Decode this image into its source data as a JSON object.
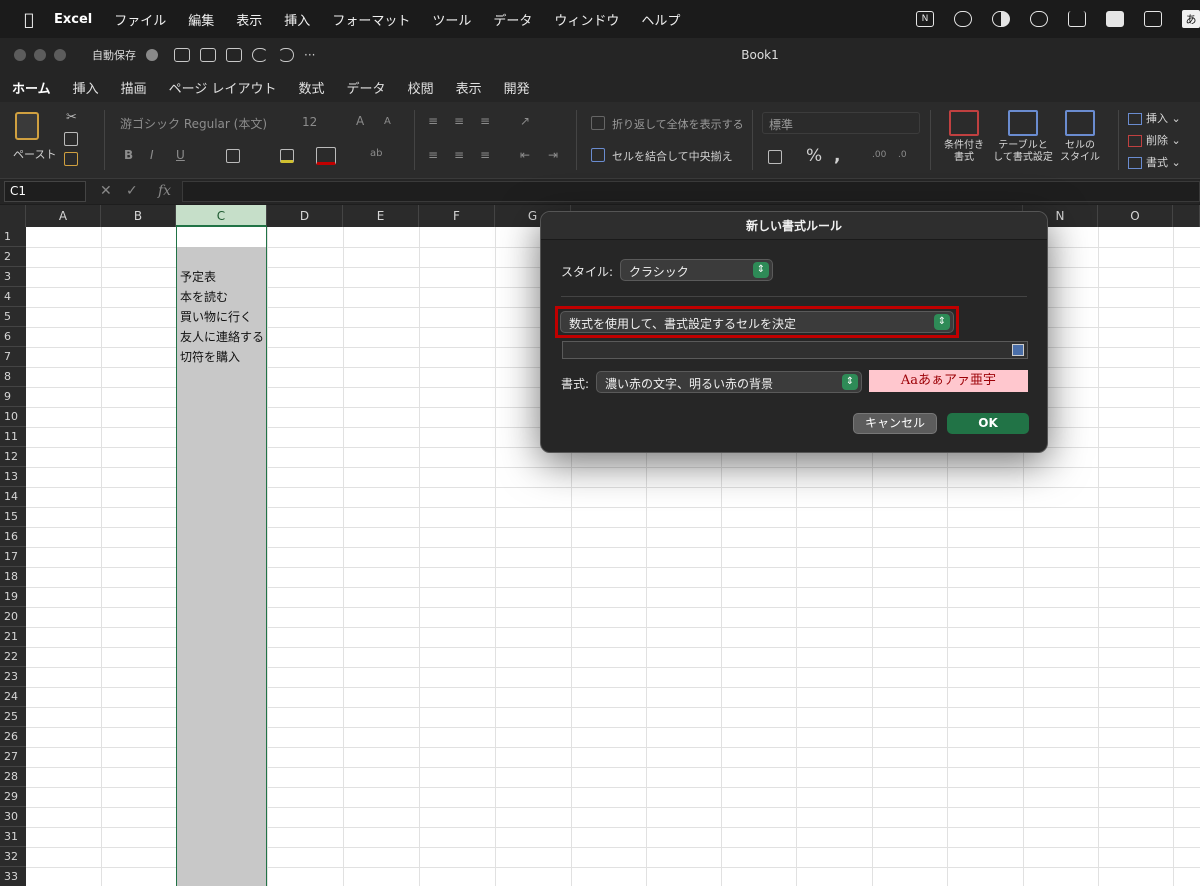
{
  "menubar": {
    "apple": "",
    "app": "Excel",
    "items": [
      "ファイル",
      "編集",
      "表示",
      "挿入",
      "フォーマット",
      "ツール",
      "データ",
      "ウィンドウ",
      "ヘルプ"
    ],
    "status_icons": [
      "notion-icon",
      "vpn-icon",
      "dark-mode-icon",
      "timer-icon",
      "download-icon",
      "layout-icon",
      "display-icon"
    ],
    "ime": "あ"
  },
  "window": {
    "autosave_label": "自動保存",
    "title": "Book1"
  },
  "ribbon_tabs": [
    "ホーム",
    "挿入",
    "描画",
    "ページ レイアウト",
    "数式",
    "データ",
    "校閲",
    "表示",
    "開発"
  ],
  "ribbon": {
    "paste_label": "ペースト",
    "font_name": "游ゴシック Regular (本文)",
    "font_size": "12",
    "wrap_text": "折り返して全体を表示する",
    "merge_center": "セルを結合して中央揃え",
    "number_format": "標準",
    "percent": "%",
    "conditional_format": "条件付き\n書式",
    "conditional_format_l1": "条件付き",
    "conditional_format_l2": "書式",
    "format_as_table_l1": "テーブルと",
    "format_as_table_l2": "して書式設定",
    "cell_styles_l1": "セルの",
    "cell_styles_l2": "スタイル",
    "insert": "挿入",
    "delete": "削除",
    "format": "書式"
  },
  "formula_bar": {
    "name_box": "C1",
    "fx": "fx",
    "content": ""
  },
  "sheet": {
    "columns": [
      "A",
      "B",
      "C",
      "D",
      "E",
      "F",
      "G",
      "N",
      "O"
    ],
    "selected_column": "C",
    "rows": [
      "1",
      "2",
      "3",
      "4",
      "5",
      "6",
      "7",
      "8",
      "9",
      "10",
      "11",
      "12",
      "13",
      "14",
      "15",
      "16",
      "17",
      "18",
      "19",
      "20",
      "21",
      "22",
      "23",
      "24",
      "25",
      "26",
      "27",
      "28",
      "29",
      "30",
      "31",
      "32",
      "33"
    ],
    "cells_c": [
      "",
      "",
      "予定表",
      "本を読む",
      "買い物に行く",
      "友人に連絡する",
      "切符を購入"
    ]
  },
  "dialog": {
    "title": "新しい書式ルール",
    "style_label": "スタイル:",
    "style_value": "クラシック",
    "rule_type": "数式を使用して、書式設定するセルを決定",
    "formula_value": "",
    "format_label": "書式:",
    "format_value": "濃い赤の文字、明るい赤の背景",
    "preview_text": "Aaあぁアァ亜宇",
    "cancel_label": "キャンセル",
    "ok_label": "OK"
  }
}
